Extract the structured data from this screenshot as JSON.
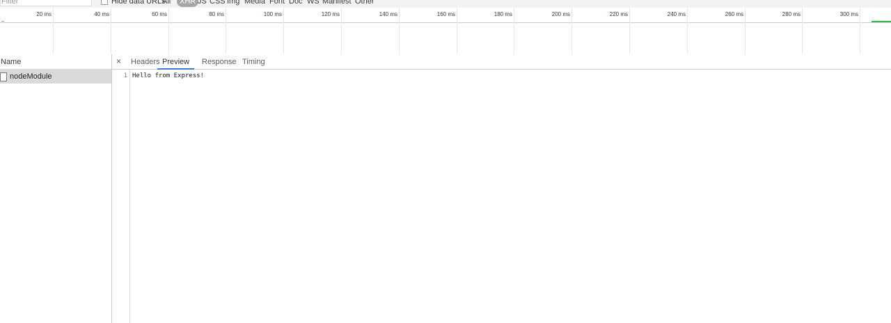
{
  "filterbar": {
    "filter_placeholder": "Filter",
    "hide_data_urls": "Hide data URLs",
    "types": [
      "All",
      "XHR",
      "JS",
      "CSS",
      "Img",
      "Media",
      "Font",
      "Doc",
      "WS",
      "Manifest",
      "Other"
    ],
    "selected_type": "XHR"
  },
  "timeline": {
    "ticks": [
      "20 ms",
      "40 ms",
      "60 ms",
      "80 ms",
      "100 ms",
      "120 ms",
      "140 ms",
      "160 ms",
      "180 ms",
      "200 ms",
      "220 ms",
      "240 ms",
      "260 ms",
      "280 ms",
      "300 ms"
    ]
  },
  "requests": {
    "header": "Name",
    "items": [
      {
        "name": "nodeModule"
      }
    ]
  },
  "details": {
    "close_label": "×",
    "tabs": [
      "Headers",
      "Preview",
      "Response",
      "Timing"
    ],
    "active_tab": "Preview",
    "preview": {
      "line_number": "1",
      "content": "Hello from Express!"
    }
  }
}
